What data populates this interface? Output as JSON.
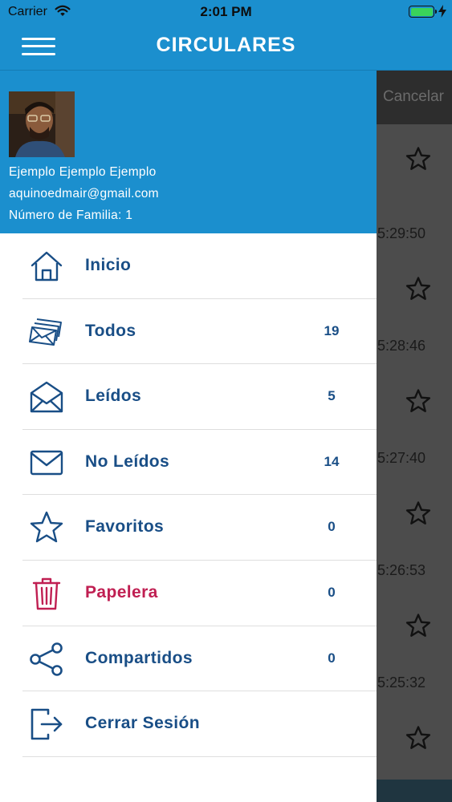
{
  "status_bar": {
    "carrier": "Carrier",
    "time": "2:01 PM",
    "battery_level": 1.0,
    "charging_icon": "bolt-icon",
    "wifi_icon": "wifi-icon"
  },
  "navbar": {
    "title": "CIRCULARES",
    "menu_icon": "hamburger-icon"
  },
  "profile": {
    "name": "Ejemplo Ejemplo Ejemplo",
    "email": "aquinoedmair@gmail.com",
    "family_number": "Número de Familia: 1"
  },
  "menu": {
    "items": [
      {
        "label": "Inicio",
        "count": "",
        "icon": "home-icon"
      },
      {
        "label": "Todos",
        "count": "19",
        "icon": "stacked-envelopes-icon"
      },
      {
        "label": "Leídos",
        "count": "5",
        "icon": "open-envelope-icon"
      },
      {
        "label": "No Leídos",
        "count": "14",
        "icon": "closed-envelope-icon"
      },
      {
        "label": "Favoritos",
        "count": "0",
        "icon": "star-icon"
      },
      {
        "label": "Papelera",
        "count": "0",
        "icon": "trash-icon"
      },
      {
        "label": "Compartidos",
        "count": "0",
        "icon": "share-icon"
      },
      {
        "label": "Cerrar Sesión",
        "count": "",
        "icon": "logout-icon"
      }
    ]
  },
  "background": {
    "cancel_label": "Cancelar",
    "times": [
      "5:29:50",
      "5:28:46",
      "5:27:40",
      "5:26:53",
      "5:25:32"
    ]
  },
  "colors": {
    "primary": "#1b8fce",
    "menu_text": "#194e86",
    "danger": "#c01f52",
    "overlay": "#4c4c4c"
  }
}
